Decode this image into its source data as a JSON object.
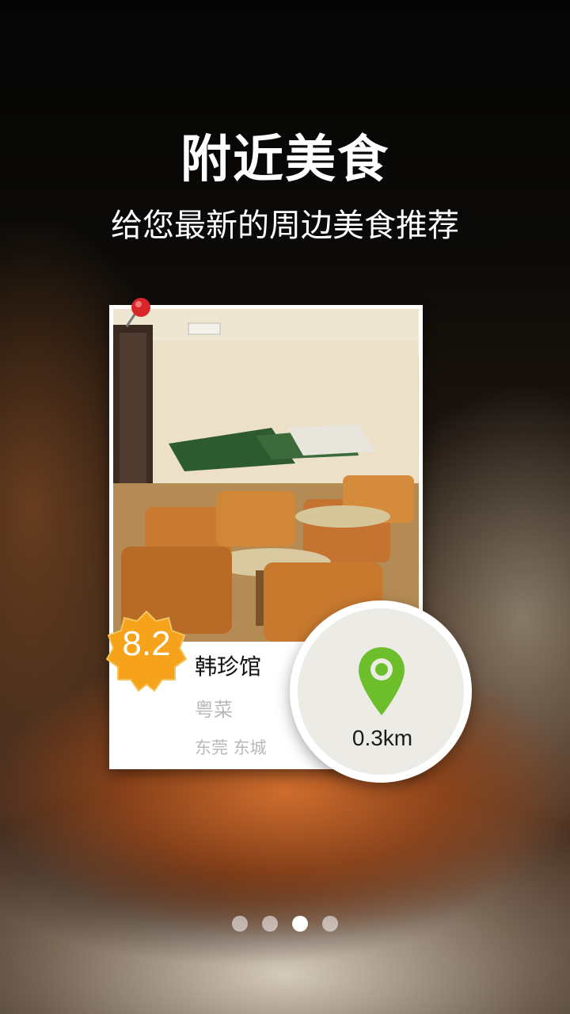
{
  "header": {
    "title": "附近美食",
    "subtitle": "给您最新的周边美食推荐"
  },
  "restaurant": {
    "rating": "8.2",
    "name": "韩珍馆",
    "cuisine": "粤菜",
    "area": "东莞 东城",
    "distance": "0.3km"
  },
  "pager": {
    "total": 4,
    "current": 3
  },
  "colors": {
    "badge": "#f7a21b",
    "location_icon": "#6cbf2a",
    "pin": "#d8262b"
  }
}
